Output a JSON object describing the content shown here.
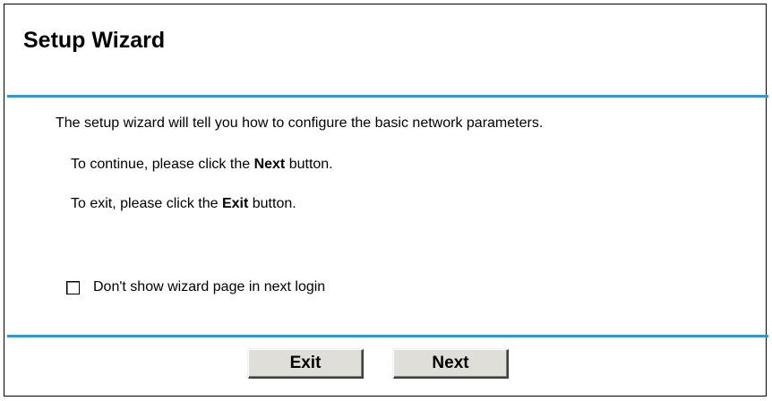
{
  "wizard": {
    "title": "Setup Wizard",
    "intro": "The setup wizard will tell you how to configure the basic network parameters.",
    "continue_pre": "To continue, please click the ",
    "continue_bold": "Next",
    "continue_post": " button.",
    "exit_pre": "To exit, please click the ",
    "exit_bold": "Exit",
    "exit_post": " button.",
    "checkbox_label": "Don't show wizard page in next login",
    "checkbox_checked": false
  },
  "buttons": {
    "exit_label": "Exit",
    "next_label": "Next"
  },
  "colors": {
    "accent_rule": "#3399cc",
    "button_face": "#e0ded8"
  }
}
